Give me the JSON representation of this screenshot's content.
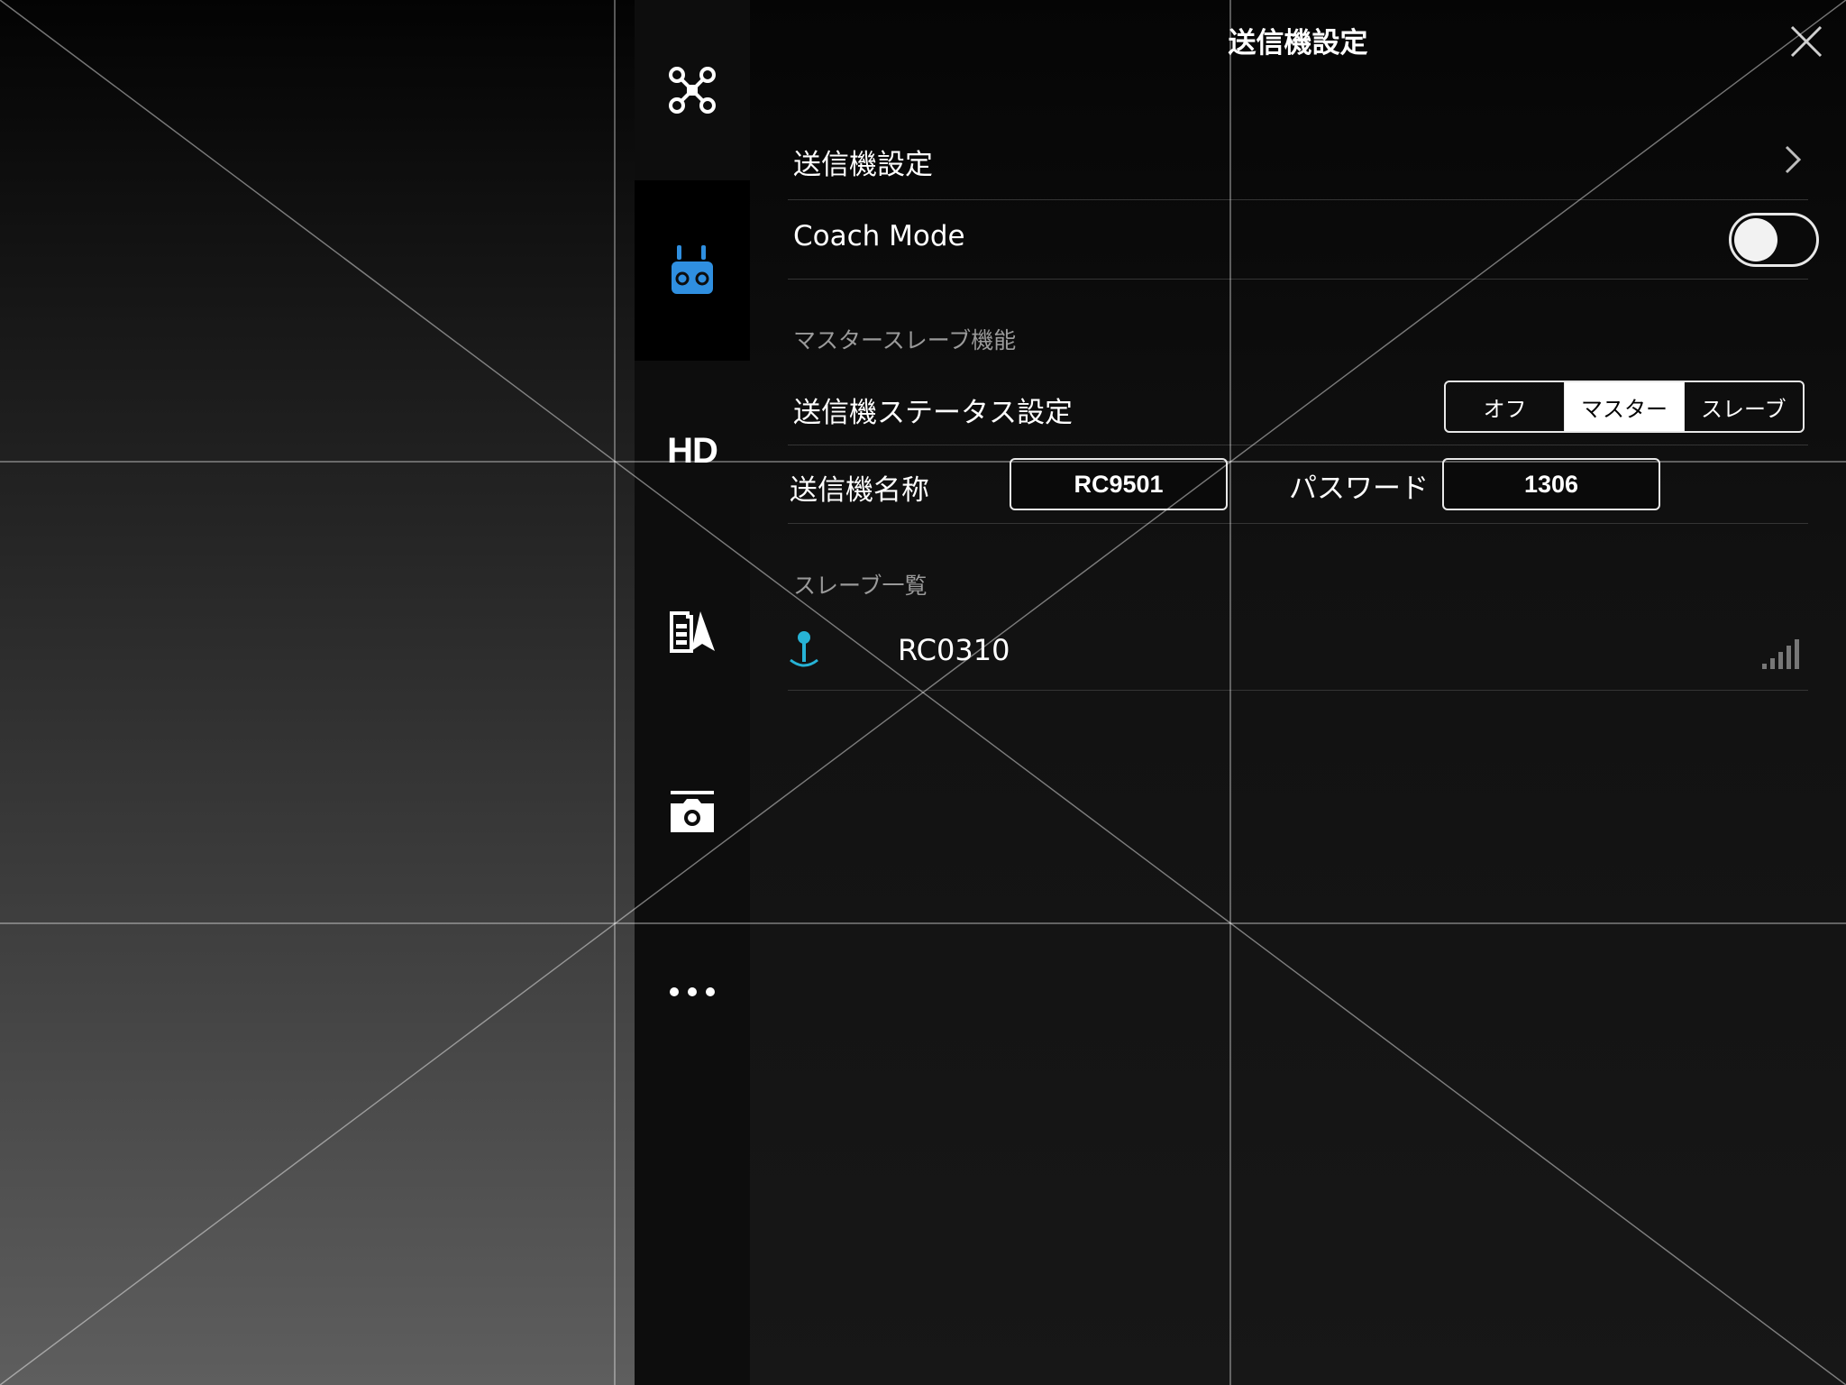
{
  "panel": {
    "title": "送信機設定"
  },
  "sidebar": {
    "items": [
      {
        "icon": "aircraft-icon"
      },
      {
        "icon": "remote-controller-icon",
        "active": true
      },
      {
        "icon": "hd-transmission-icon",
        "label": "HD"
      },
      {
        "icon": "battery-navigation-icon"
      },
      {
        "icon": "camera-icon"
      },
      {
        "icon": "more-icon"
      }
    ]
  },
  "settings": {
    "rc_settings_label": "送信機設定",
    "coach_mode_label": "Coach Mode",
    "coach_mode_on": false,
    "master_slave_section": "マスタースレーブ機能",
    "rc_status_label": "送信機ステータス設定",
    "rc_status_options": [
      "オフ",
      "マスター",
      "スレーブ"
    ],
    "rc_status_selected": "マスター",
    "rc_name_label": "送信機名称",
    "rc_name_value": "RC9501",
    "password_label": "パスワード",
    "password_value": "1306",
    "slave_list_section": "スレーブ一覧",
    "slaves": [
      {
        "name": "RC0310",
        "signal_bars": 5
      }
    ]
  },
  "colors": {
    "accent_blue": "#2f8fe0",
    "slave_icon_cyan": "#27b3d6",
    "signal_gray": "#777777"
  }
}
